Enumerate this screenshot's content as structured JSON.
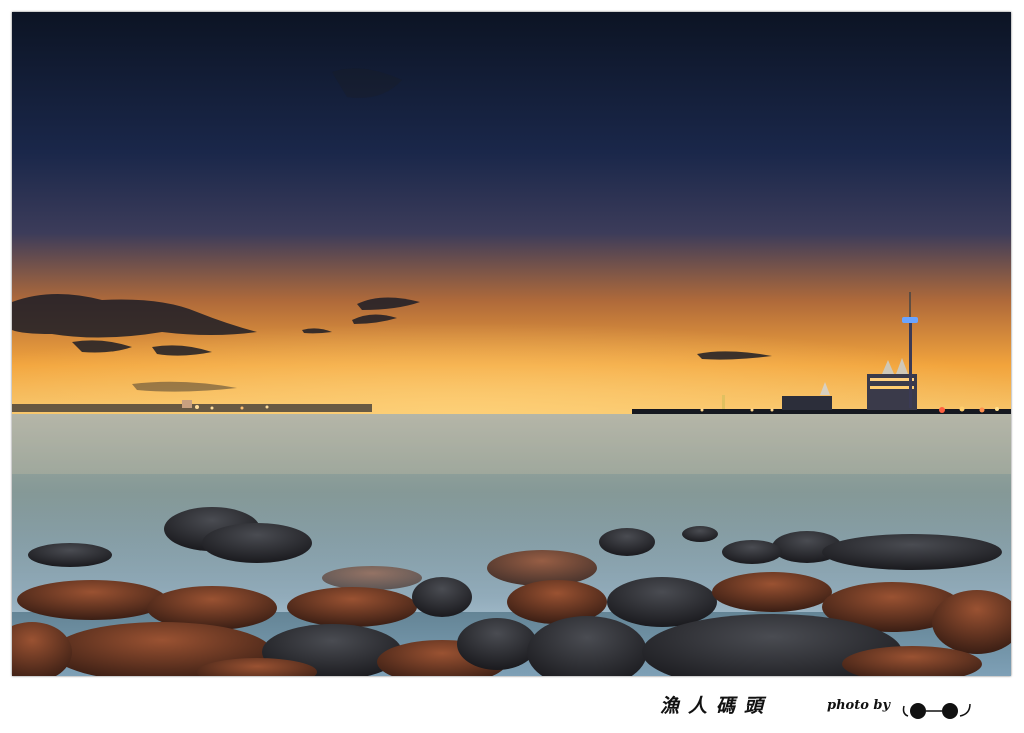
{
  "caption": {
    "title": "漁人碼頭",
    "photo_credit_prefix": "photo by",
    "signature_icon": "eyes-signature-icon"
  },
  "colors": {
    "frame": "#ffffff",
    "sky_top": "#0d1626",
    "sky_mid": "#1d2a52",
    "horizon_glow": "#f0a040",
    "sea": "#5f7f8c",
    "rocks": "#7a3d22"
  }
}
